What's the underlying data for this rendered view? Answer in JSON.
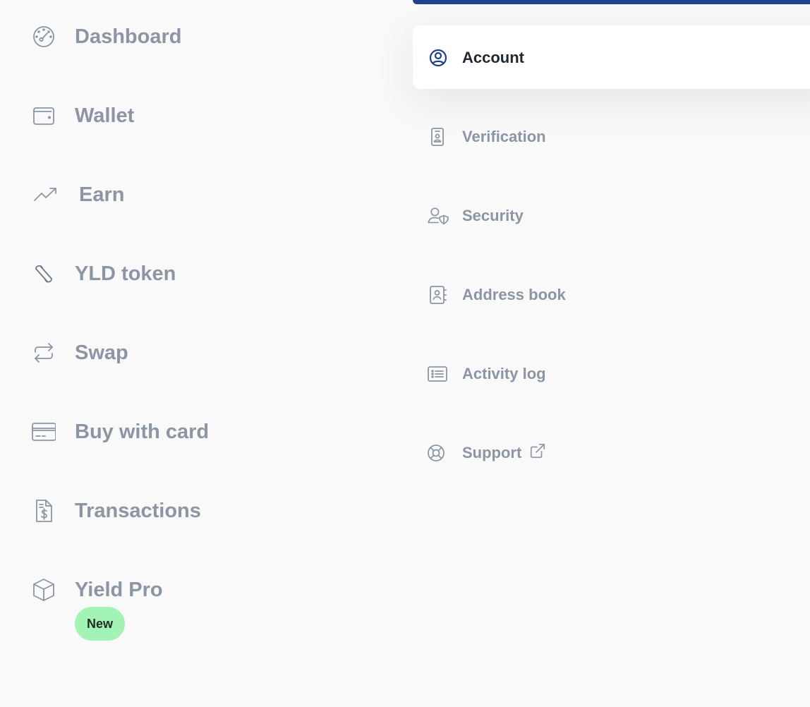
{
  "sidebar": {
    "items": [
      {
        "label": "Dashboard",
        "icon": "dashboard-gauge-icon"
      },
      {
        "label": "Wallet",
        "icon": "wallet-icon"
      },
      {
        "label": "Earn",
        "icon": "trending-up-icon"
      },
      {
        "label": "YLD token",
        "icon": "yld-token-icon"
      },
      {
        "label": "Swap",
        "icon": "swap-arrows-icon"
      },
      {
        "label": "Buy with card",
        "icon": "credit-card-icon"
      },
      {
        "label": "Transactions",
        "icon": "receipt-dollar-icon"
      },
      {
        "label": "Yield Pro",
        "icon": "cube-icon",
        "badge": "New"
      }
    ]
  },
  "submenu": {
    "items": [
      {
        "label": "Account",
        "icon": "user-circle-icon",
        "active": true
      },
      {
        "label": "Verification",
        "icon": "id-badge-icon"
      },
      {
        "label": "Security",
        "icon": "user-shield-icon"
      },
      {
        "label": "Address book",
        "icon": "contact-book-icon"
      },
      {
        "label": "Activity log",
        "icon": "list-icon"
      },
      {
        "label": "Support",
        "icon": "lifebuoy-icon",
        "external_icon": "external-link-icon"
      }
    ]
  },
  "colors": {
    "background": "#f9f9f9",
    "text_muted": "#8b95a4",
    "text_active": "#222831",
    "accent_bar": "#20418c",
    "active_icon": "#1f3f86",
    "badge_bg": "#a3f3b7"
  }
}
